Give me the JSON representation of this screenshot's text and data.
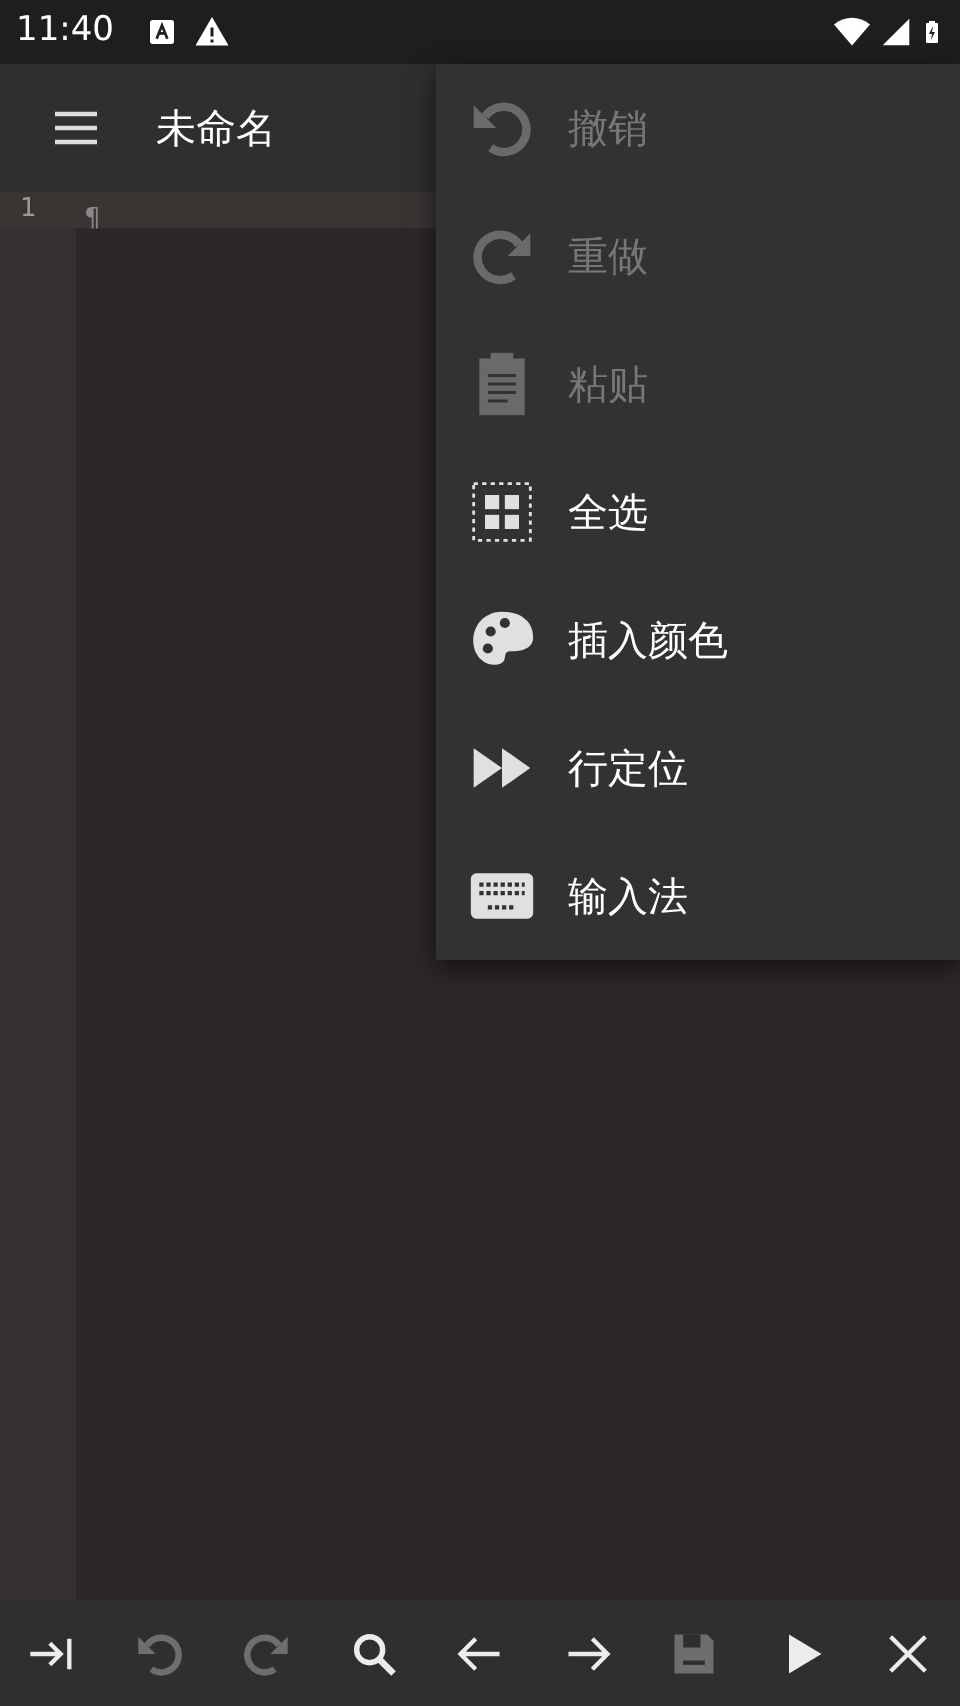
{
  "status_bar": {
    "time": "11:40"
  },
  "app_bar": {
    "title": "未命名"
  },
  "editor": {
    "lines": [
      {
        "number": "1",
        "text": "¶",
        "current": true
      }
    ]
  },
  "menu": {
    "items": [
      {
        "label": "撤销",
        "kind": "undo",
        "disabled": true
      },
      {
        "label": "重做",
        "kind": "redo",
        "disabled": true
      },
      {
        "label": "粘贴",
        "kind": "paste",
        "disabled": true
      },
      {
        "label": "全选",
        "kind": "select-all",
        "disabled": false
      },
      {
        "label": "插入颜色",
        "kind": "palette",
        "disabled": false
      },
      {
        "label": "行定位",
        "kind": "goto",
        "disabled": false
      },
      {
        "label": "输入法",
        "kind": "keyboard",
        "disabled": false
      }
    ]
  },
  "toolbar": {
    "buttons": [
      {
        "kind": "tab",
        "disabled": false
      },
      {
        "kind": "undo",
        "disabled": true
      },
      {
        "kind": "redo",
        "disabled": true
      },
      {
        "kind": "search",
        "disabled": false
      },
      {
        "kind": "left",
        "disabled": false
      },
      {
        "kind": "right",
        "disabled": false
      },
      {
        "kind": "save",
        "disabled": true
      },
      {
        "kind": "run",
        "disabled": false
      },
      {
        "kind": "close",
        "disabled": false
      }
    ]
  }
}
